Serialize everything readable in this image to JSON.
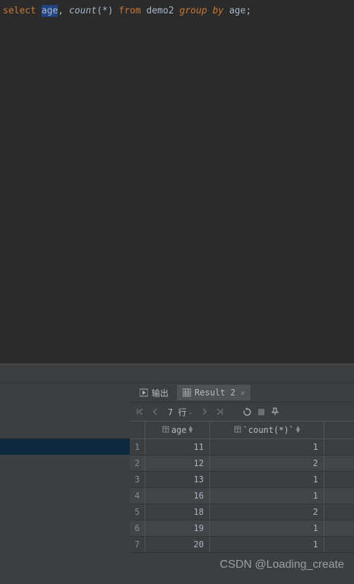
{
  "editor": {
    "tokens": [
      {
        "text": "select",
        "cls": "sql-keyword"
      },
      {
        "text": " ",
        "cls": "sql-punct"
      },
      {
        "text": "age",
        "cls": "sql-ident",
        "sel": true
      },
      {
        "text": ",",
        "cls": "sql-punct"
      },
      {
        "text": " ",
        "cls": "sql-punct"
      },
      {
        "text": "count",
        "cls": "sql-func"
      },
      {
        "text": "(",
        "cls": "sql-punct"
      },
      {
        "text": "*",
        "cls": "sql-star"
      },
      {
        "text": ")",
        "cls": "sql-punct"
      },
      {
        "text": " ",
        "cls": "sql-punct"
      },
      {
        "text": "from",
        "cls": "sql-keyword"
      },
      {
        "text": " ",
        "cls": "sql-punct"
      },
      {
        "text": "demo2",
        "cls": "sql-ident"
      },
      {
        "text": " ",
        "cls": "sql-punct"
      },
      {
        "text": "group by",
        "cls": "sql-keyword-italic"
      },
      {
        "text": " ",
        "cls": "sql-punct"
      },
      {
        "text": "age",
        "cls": "sql-ident"
      },
      {
        "text": ";",
        "cls": "sql-punct"
      }
    ]
  },
  "tabs": {
    "output_label": "输出",
    "result_label": "Result 2"
  },
  "toolbar": {
    "row_count": "7 行"
  },
  "grid": {
    "columns": [
      {
        "name": "age",
        "cls": "col-age"
      },
      {
        "name": "`count(*)`",
        "cls": "col-count"
      }
    ],
    "rows": [
      {
        "n": "1",
        "cells": [
          "11",
          "1"
        ]
      },
      {
        "n": "2",
        "cells": [
          "12",
          "2"
        ]
      },
      {
        "n": "3",
        "cells": [
          "13",
          "1"
        ]
      },
      {
        "n": "4",
        "cells": [
          "16",
          "1"
        ]
      },
      {
        "n": "5",
        "cells": [
          "18",
          "2"
        ]
      },
      {
        "n": "6",
        "cells": [
          "19",
          "1"
        ]
      },
      {
        "n": "7",
        "cells": [
          "20",
          "1"
        ]
      }
    ]
  },
  "watermark": "CSDN @Loading_create"
}
